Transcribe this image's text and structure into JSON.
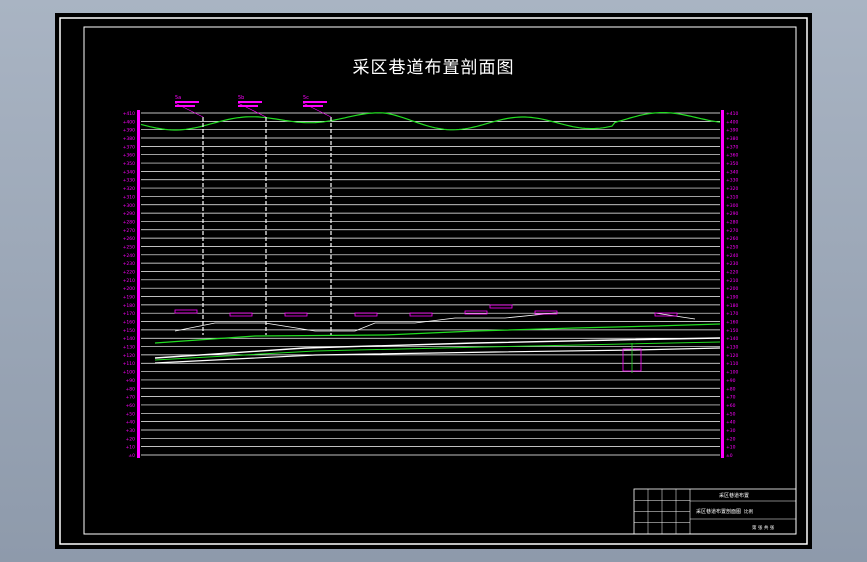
{
  "drawing": {
    "title": "采区巷道布置剖面图",
    "elevation_labels_left": [
      "+410",
      "+400",
      "+390",
      "+380",
      "+370",
      "+360",
      "+350",
      "+340",
      "+330",
      "+320",
      "+310",
      "+300",
      "+290",
      "+280",
      "+270",
      "+260",
      "+250",
      "+240",
      "+230",
      "+220",
      "+210",
      "+200",
      "+190",
      "+180",
      "+170",
      "+160",
      "+150",
      "+140",
      "+130",
      "+120",
      "+110",
      "+100",
      "+90",
      "+80",
      "+70",
      "+60",
      "+50",
      "+40",
      "+30",
      "+20",
      "+10",
      "±0"
    ],
    "boreholes": [
      {
        "label": "5a"
      },
      {
        "label": "5b"
      },
      {
        "label": "5c"
      }
    ],
    "title_block": {
      "header": "采区巷道布置",
      "name": "采区巷道布置剖面图",
      "scale_label": "比例",
      "sheet_label": "第 张 共 张"
    }
  },
  "colors": {
    "background": "#000000",
    "frame": "#ffffff",
    "grid": "#ffffff",
    "magenta": "#ff00ff",
    "green": "#22dd22"
  }
}
